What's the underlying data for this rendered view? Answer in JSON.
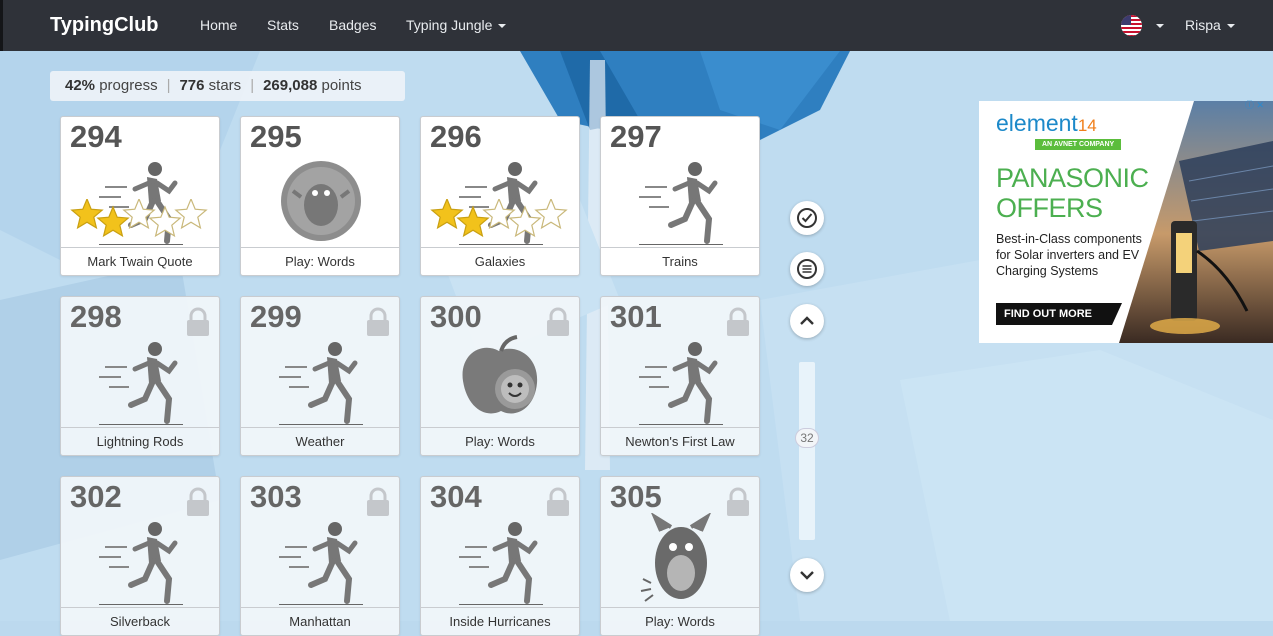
{
  "navbar": {
    "brand": "TypingClub",
    "items": [
      {
        "label": "Home"
      },
      {
        "label": "Stats"
      },
      {
        "label": "Badges"
      },
      {
        "label": "Typing Jungle"
      }
    ],
    "user": "Rispa"
  },
  "progress": {
    "percent": "42%",
    "percent_label": "progress",
    "stars": "776",
    "stars_label": "stars",
    "points": "269,088",
    "points_label": "points"
  },
  "tiles": [
    {
      "num": "294",
      "label": "Mark Twain Quote",
      "icon": "runner-icon",
      "locked": false,
      "stars_earned": 2,
      "stars_total": 5
    },
    {
      "num": "295",
      "label": "Play: Words",
      "icon": "game-bubble-icon",
      "locked": false
    },
    {
      "num": "296",
      "label": "Galaxies",
      "icon": "runner-icon",
      "locked": false,
      "stars_earned": 2,
      "stars_total": 5
    },
    {
      "num": "297",
      "label": "Trains",
      "icon": "runner-icon",
      "locked": false
    },
    {
      "num": "298",
      "label": "Lightning Rods",
      "icon": "runner-icon",
      "locked": true
    },
    {
      "num": "299",
      "label": "Weather",
      "icon": "runner-icon",
      "locked": true
    },
    {
      "num": "300",
      "label": "Play: Words",
      "icon": "apple-worm-icon",
      "locked": true
    },
    {
      "num": "301",
      "label": "Newton's First Law",
      "icon": "runner-icon",
      "locked": true
    },
    {
      "num": "302",
      "label": "Silverback",
      "icon": "runner-icon",
      "locked": true
    },
    {
      "num": "303",
      "label": "Manhattan",
      "icon": "runner-icon",
      "locked": true
    },
    {
      "num": "304",
      "label": "Inside Hurricanes",
      "icon": "runner-icon",
      "locked": true
    },
    {
      "num": "305",
      "label": "Play: Words",
      "icon": "monster-icon",
      "locked": true
    }
  ],
  "controls": {
    "scroll_value": "32"
  },
  "ad": {
    "logo": "element",
    "logo_suffix": "14",
    "logo_sub": "AN AVNET COMPANY",
    "headline_1": "PANASONIC",
    "headline_2": "OFFERS",
    "body": "Best-in-Class components for Solar inverters and EV Charging Systems",
    "cta": "FIND OUT MORE"
  },
  "colors": {
    "navbar": "#2f3239",
    "background": "#bcd9ee",
    "star": "#f2c21b",
    "ad_green": "#4caf50",
    "ad_blue": "#1c89c9"
  }
}
